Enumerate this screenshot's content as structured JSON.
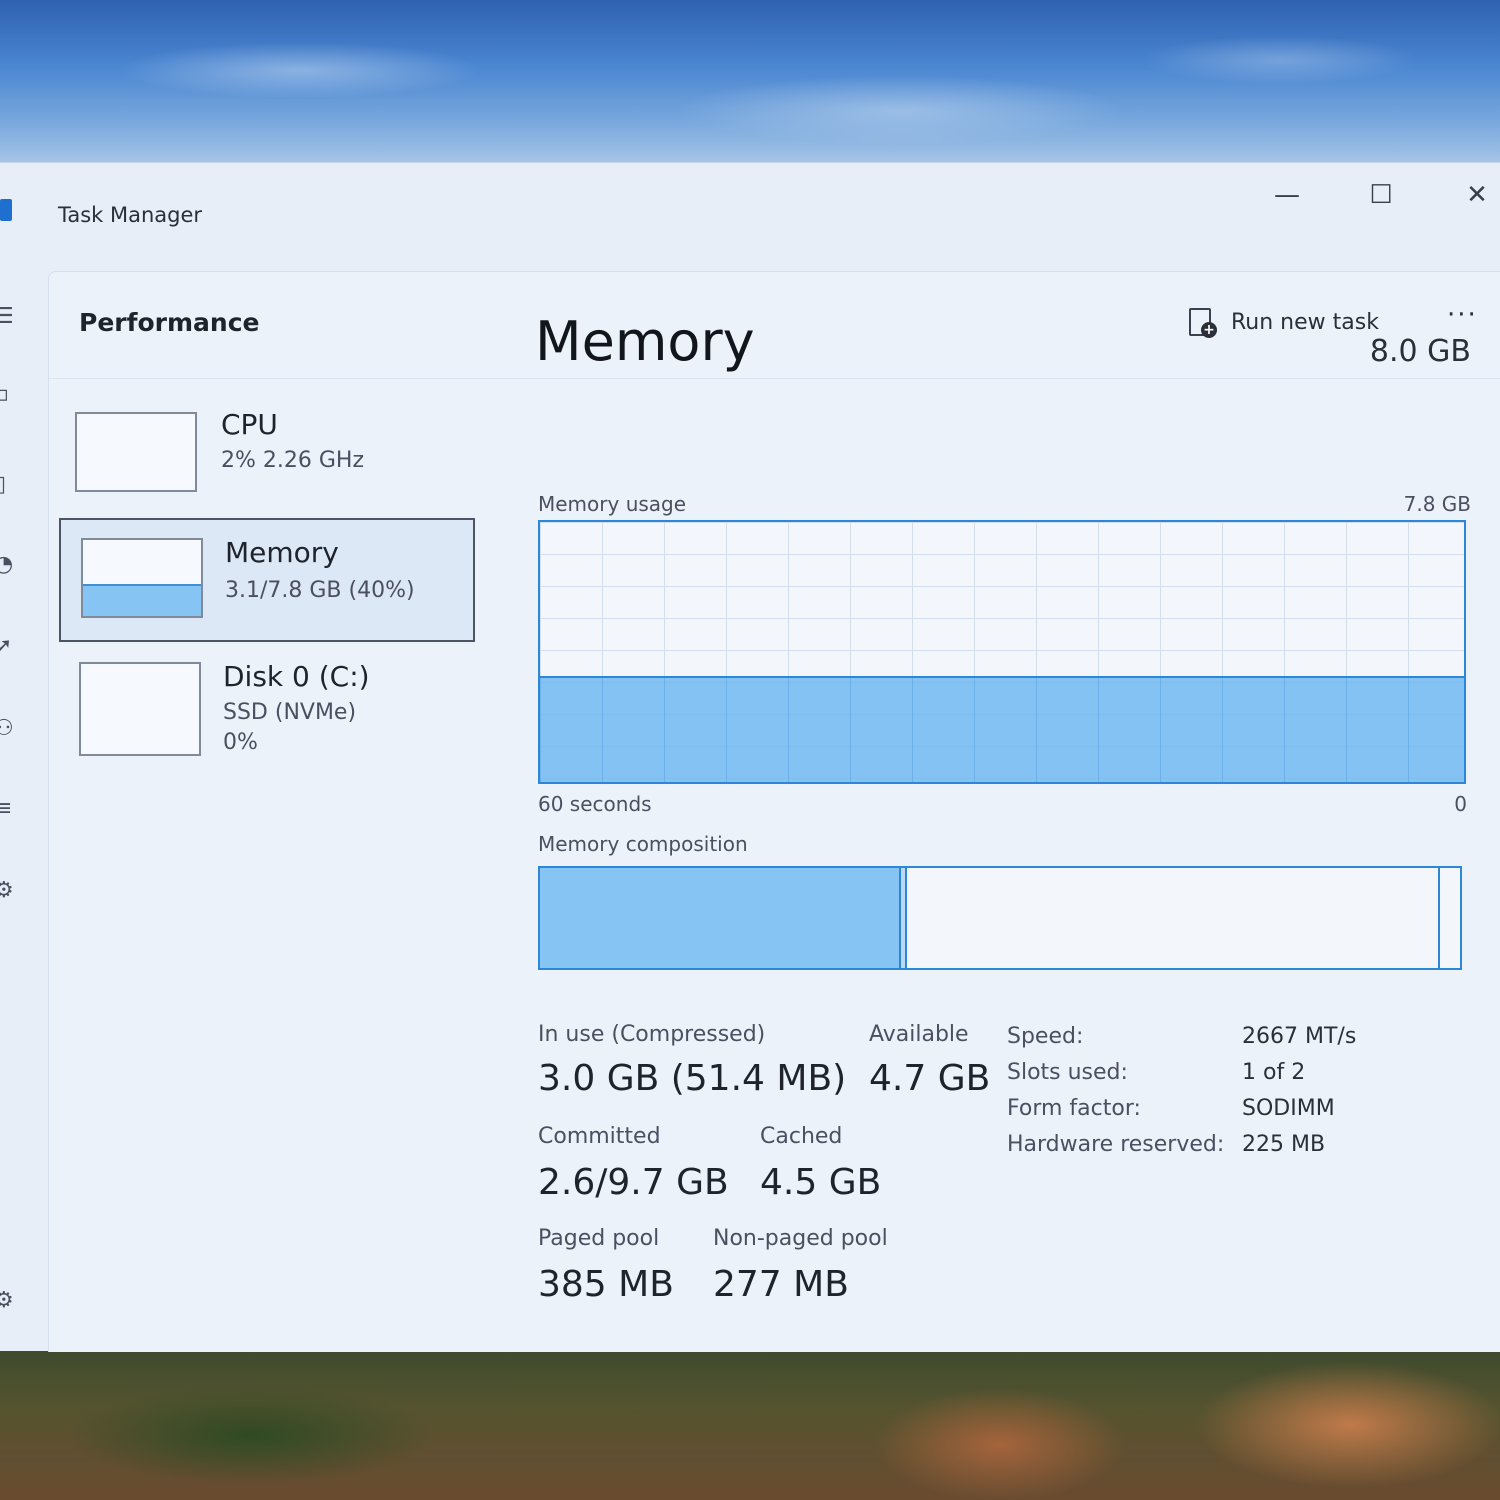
{
  "window": {
    "title": "Task Manager",
    "controls": {
      "minimize": "—",
      "maximize": "☐",
      "close": "✕"
    }
  },
  "header": {
    "page_title": "Performance",
    "run_new_task_label": "Run new task",
    "more_label": "···"
  },
  "sidebar": {
    "items": [
      {
        "name": "CPU",
        "detail": "2% 2.26 GHz",
        "selected": false
      },
      {
        "name": "Memory",
        "detail": "3.1/7.8 GB (40%)",
        "selected": true,
        "usage_fraction": 0.4
      },
      {
        "name": "Disk 0 (C:)",
        "detail": "SSD (NVMe)",
        "detail2": "0%",
        "selected": false
      }
    ]
  },
  "memory": {
    "title": "Memory",
    "total": "8.0 GB",
    "usage_graph": {
      "label": "Memory usage",
      "max_label": "7.8 GB",
      "time_left_label": "60 seconds",
      "time_right_label": "0",
      "usage_fraction": 0.4
    },
    "composition": {
      "label": "Memory composition",
      "in_use_fraction": 0.39
    },
    "stats": {
      "in_use_label": "In use (Compressed)",
      "in_use_value": "3.0 GB (51.4 MB)",
      "available_label": "Available",
      "available_value": "4.7 GB",
      "committed_label": "Committed",
      "committed_value": "2.6/9.7 GB",
      "cached_label": "Cached",
      "cached_value": "4.5 GB",
      "paged_pool_label": "Paged pool",
      "paged_pool_value": "385 MB",
      "nonpaged_pool_label": "Non-paged pool",
      "nonpaged_pool_value": "277 MB"
    },
    "specs": {
      "speed_label": "Speed:",
      "speed_value": "2667 MT/s",
      "slots_label": "Slots used:",
      "slots_value": "1 of 2",
      "form_label": "Form factor:",
      "form_value": "SODIMM",
      "reserved_label": "Hardware reserved:",
      "reserved_value": "225 MB"
    }
  },
  "colors": {
    "accent": "#2e86d6",
    "fill": "#86c5f3",
    "window_bg": "#e7eef8"
  },
  "icons": {
    "rail": [
      "hamburger-menu-icon",
      "processes-icon",
      "performance-icon",
      "app-history-icon",
      "startup-apps-icon",
      "users-icon",
      "details-icon",
      "services-icon",
      "settings-icon"
    ]
  }
}
